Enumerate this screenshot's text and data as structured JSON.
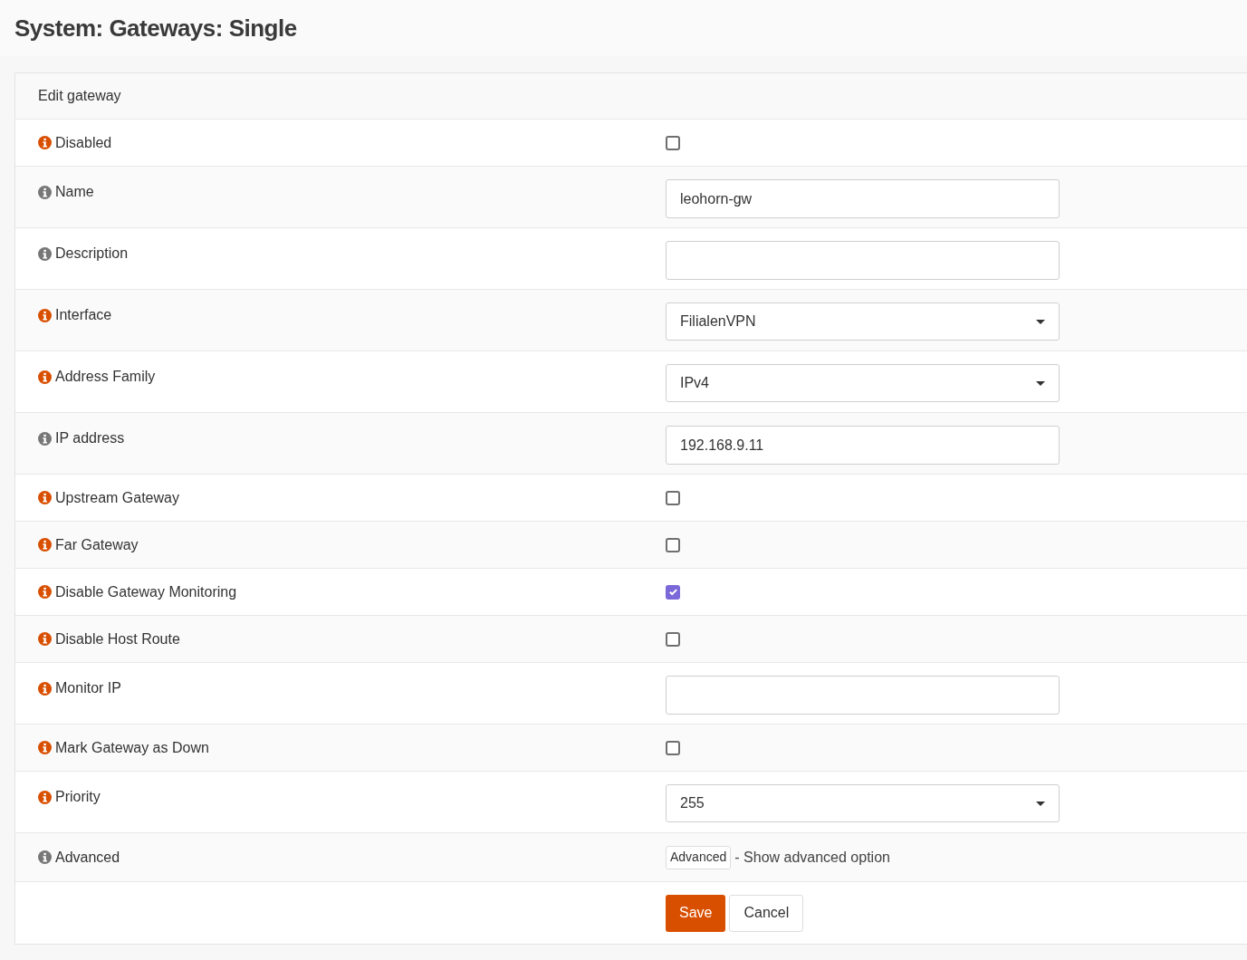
{
  "page_title": "System: Gateways: Single",
  "panel": {
    "title": "Edit gateway",
    "rows": [
      {
        "label": "Disabled",
        "color": "#d94f00",
        "kind": "checkbox",
        "checked": false
      },
      {
        "label": "Name",
        "color": "#777777",
        "kind": "text",
        "value": "leohorn-gw"
      },
      {
        "label": "Description",
        "color": "#777777",
        "kind": "text",
        "value": ""
      },
      {
        "label": "Interface",
        "color": "#d94f00",
        "kind": "select",
        "value": "FilialenVPN"
      },
      {
        "label": "Address Family",
        "color": "#d94f00",
        "kind": "select",
        "value": "IPv4"
      },
      {
        "label": "IP address",
        "color": "#777777",
        "kind": "text",
        "value": "192.168.9.11"
      },
      {
        "label": "Upstream Gateway",
        "color": "#d94f00",
        "kind": "checkbox",
        "checked": false
      },
      {
        "label": "Far Gateway",
        "color": "#d94f00",
        "kind": "checkbox",
        "checked": false
      },
      {
        "label": "Disable Gateway Monitoring",
        "color": "#d94f00",
        "kind": "checkbox",
        "checked": true
      },
      {
        "label": "Disable Host Route",
        "color": "#d94f00",
        "kind": "checkbox",
        "checked": false
      },
      {
        "label": "Monitor IP",
        "color": "#d94f00",
        "kind": "text",
        "value": ""
      },
      {
        "label": "Mark Gateway as Down",
        "color": "#d94f00",
        "kind": "checkbox",
        "checked": false
      },
      {
        "label": "Priority",
        "color": "#d94f00",
        "kind": "select",
        "value": "255"
      },
      {
        "label": "Advanced",
        "color": "#777777",
        "kind": "advanced",
        "button": "Advanced",
        "note": "- Show advanced option"
      }
    ],
    "buttons": {
      "save": "Save",
      "cancel": "Cancel"
    }
  }
}
